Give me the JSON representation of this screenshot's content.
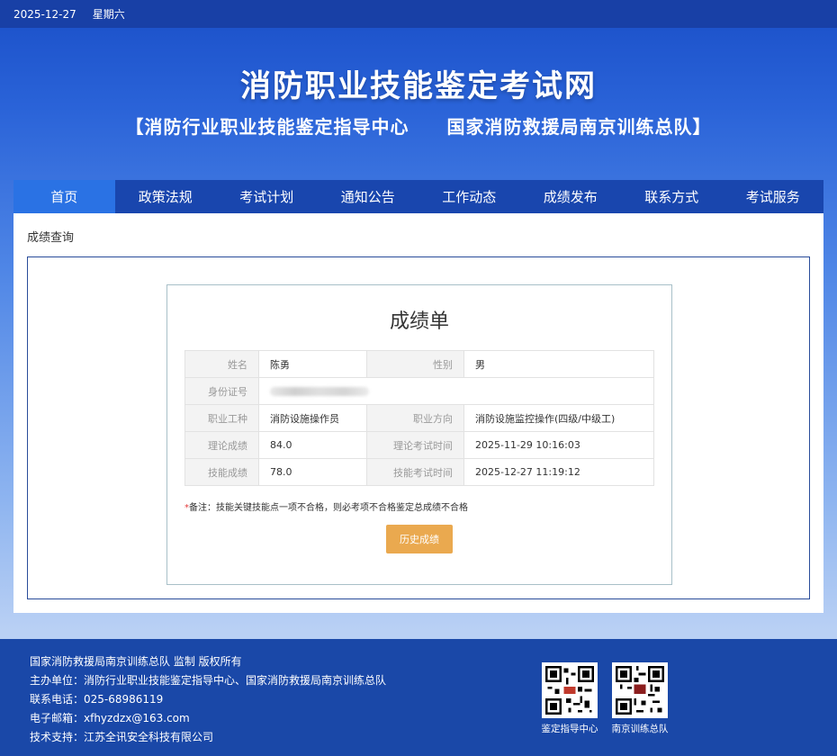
{
  "topbar": {
    "date": "2025-12-27",
    "weekday": "星期六"
  },
  "header": {
    "title": "消防职业技能鉴定考试网",
    "subtitle": "【消防行业职业技能鉴定指导中心　　国家消防救援局南京训练总队】"
  },
  "nav": {
    "items": [
      "首页",
      "政策法规",
      "考试计划",
      "通知公告",
      "工作动态",
      "成绩发布",
      "联系方式",
      "考试服务"
    ],
    "active": "首页"
  },
  "breadcrumb": "成绩查询",
  "scorecard": {
    "title": "成绩单",
    "rows": {
      "name_label": "姓名",
      "name_value": "陈勇",
      "gender_label": "性别",
      "gender_value": "男",
      "id_label": "身份证号",
      "id_value": "",
      "job_label": "职业工种",
      "job_value": "消防设施操作员",
      "direction_label": "职业方向",
      "direction_value": "消防设施监控操作(四级/中级工)",
      "theory_label": "理论成绩",
      "theory_value": "84.0",
      "theory_time_label": "理论考试时间",
      "theory_time_value": "2025-11-29 10:16:03",
      "skill_label": "技能成绩",
      "skill_value": "78.0",
      "skill_time_label": "技能考试时间",
      "skill_time_value": "2025-12-27 11:19:12"
    },
    "note_star": "*",
    "note": "备注：技能关键技能点一项不合格，则必考项不合格鉴定总成绩不合格",
    "history_button": "历史成绩"
  },
  "footer": {
    "line1": "国家消防救援局南京训练总队 监制 版权所有",
    "line2": "主办单位：消防行业职业技能鉴定指导中心、国家消防救援局南京训练总队",
    "line3": "联系电话：025-68986119",
    "line4": "电子邮箱：xfhyzdzx@163.com",
    "line5": "技术支持：江苏全讯安全科技有限公司",
    "qr1_label": "鉴定指导中心",
    "qr2_label": "南京训练总队"
  },
  "colors": {
    "nav_bg": "#1946ae",
    "nav_active": "#2a72e4",
    "button": "#eaa94f",
    "highlight": "#4b8fd0"
  },
  "icons": [
    "qr-code-icon"
  ]
}
